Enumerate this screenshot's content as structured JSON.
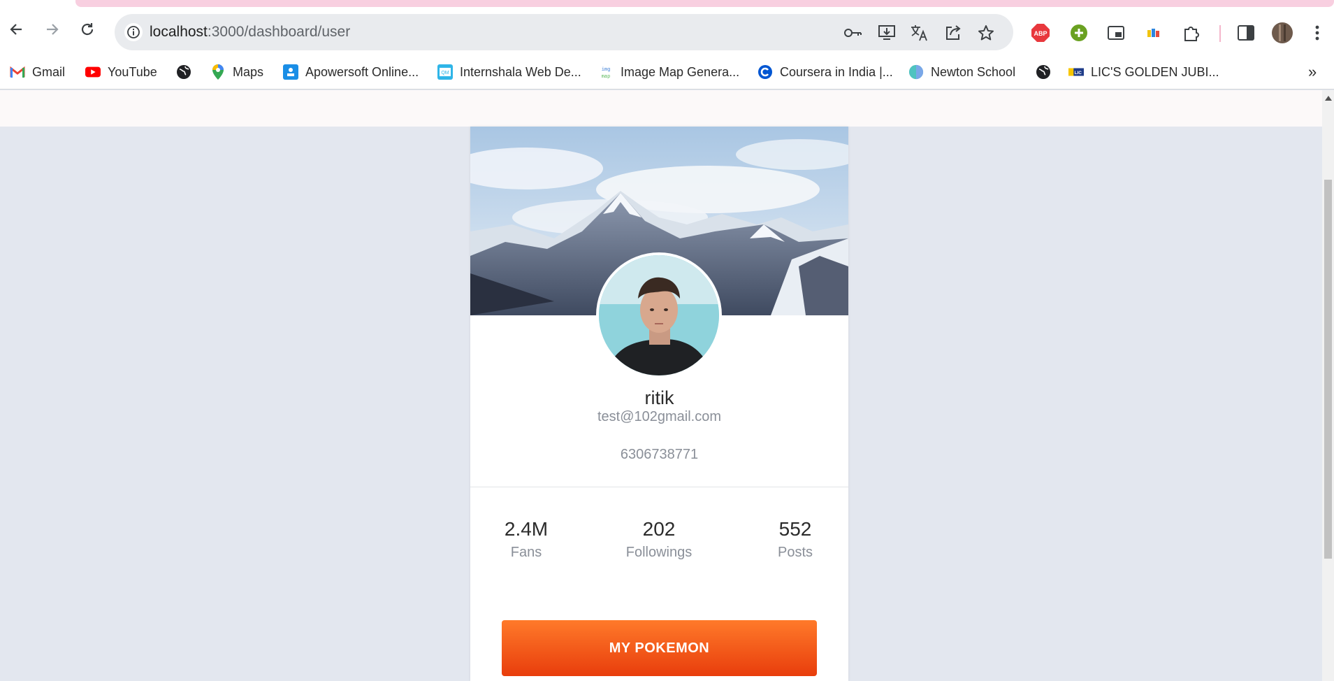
{
  "browser": {
    "url_host": "localhost",
    "url_path": ":3000/dashboard/user",
    "bookmarks": [
      {
        "label": "Gmail",
        "icon": "gmail-icon"
      },
      {
        "label": "YouTube",
        "icon": "youtube-icon"
      },
      {
        "label": "",
        "icon": "globe-icon"
      },
      {
        "label": "Maps",
        "icon": "maps-icon"
      },
      {
        "label": "Apowersoft Online...",
        "icon": "apowersoft-icon"
      },
      {
        "label": "Internshala Web De...",
        "icon": "internshala-icon"
      },
      {
        "label": "Image Map Genera...",
        "icon": "imgmap-icon"
      },
      {
        "label": "Coursera in India |...",
        "icon": "coursera-icon"
      },
      {
        "label": "Newton School",
        "icon": "newton-icon"
      },
      {
        "label": "",
        "icon": "globe-icon"
      },
      {
        "label": "LIC'S GOLDEN JUBI...",
        "icon": "lic-icon"
      }
    ],
    "more_bookmarks": "»"
  },
  "profile": {
    "name": "ritik",
    "email": "test@102gmail.com",
    "phone": "6306738771"
  },
  "stats": [
    {
      "value": "2.4M",
      "label": "Fans"
    },
    {
      "value": "202",
      "label": "Followings"
    },
    {
      "value": "552",
      "label": "Posts"
    }
  ],
  "cta_label": "MY POKEMON",
  "colors": {
    "page_bg": "#e3e7ef",
    "cta_top": "#ff7a2a",
    "cta_bottom": "#e83d0c",
    "muted_text": "#8a8f98"
  }
}
